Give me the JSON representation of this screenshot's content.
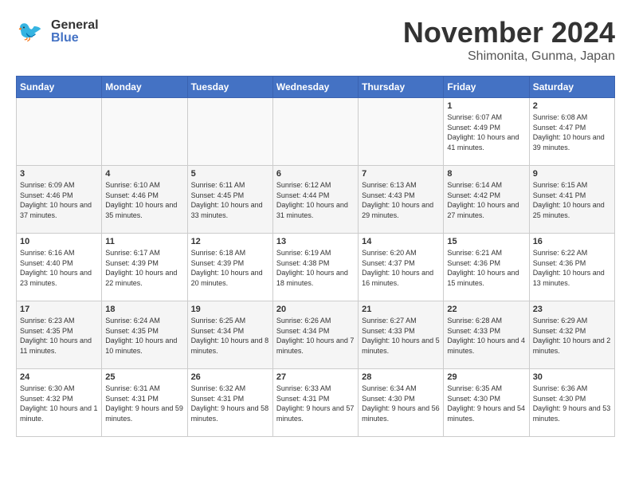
{
  "header": {
    "logo_general": "General",
    "logo_blue": "Blue",
    "title": "November 2024",
    "subtitle": "Shimonita, Gunma, Japan"
  },
  "days_of_week": [
    "Sunday",
    "Monday",
    "Tuesday",
    "Wednesday",
    "Thursday",
    "Friday",
    "Saturday"
  ],
  "weeks": [
    [
      {
        "day": "",
        "content": ""
      },
      {
        "day": "",
        "content": ""
      },
      {
        "day": "",
        "content": ""
      },
      {
        "day": "",
        "content": ""
      },
      {
        "day": "",
        "content": ""
      },
      {
        "day": "1",
        "content": "Sunrise: 6:07 AM\nSunset: 4:49 PM\nDaylight: 10 hours and 41 minutes."
      },
      {
        "day": "2",
        "content": "Sunrise: 6:08 AM\nSunset: 4:47 PM\nDaylight: 10 hours and 39 minutes."
      }
    ],
    [
      {
        "day": "3",
        "content": "Sunrise: 6:09 AM\nSunset: 4:46 PM\nDaylight: 10 hours and 37 minutes."
      },
      {
        "day": "4",
        "content": "Sunrise: 6:10 AM\nSunset: 4:46 PM\nDaylight: 10 hours and 35 minutes."
      },
      {
        "day": "5",
        "content": "Sunrise: 6:11 AM\nSunset: 4:45 PM\nDaylight: 10 hours and 33 minutes."
      },
      {
        "day": "6",
        "content": "Sunrise: 6:12 AM\nSunset: 4:44 PM\nDaylight: 10 hours and 31 minutes."
      },
      {
        "day": "7",
        "content": "Sunrise: 6:13 AM\nSunset: 4:43 PM\nDaylight: 10 hours and 29 minutes."
      },
      {
        "day": "8",
        "content": "Sunrise: 6:14 AM\nSunset: 4:42 PM\nDaylight: 10 hours and 27 minutes."
      },
      {
        "day": "9",
        "content": "Sunrise: 6:15 AM\nSunset: 4:41 PM\nDaylight: 10 hours and 25 minutes."
      }
    ],
    [
      {
        "day": "10",
        "content": "Sunrise: 6:16 AM\nSunset: 4:40 PM\nDaylight: 10 hours and 23 minutes."
      },
      {
        "day": "11",
        "content": "Sunrise: 6:17 AM\nSunset: 4:39 PM\nDaylight: 10 hours and 22 minutes."
      },
      {
        "day": "12",
        "content": "Sunrise: 6:18 AM\nSunset: 4:39 PM\nDaylight: 10 hours and 20 minutes."
      },
      {
        "day": "13",
        "content": "Sunrise: 6:19 AM\nSunset: 4:38 PM\nDaylight: 10 hours and 18 minutes."
      },
      {
        "day": "14",
        "content": "Sunrise: 6:20 AM\nSunset: 4:37 PM\nDaylight: 10 hours and 16 minutes."
      },
      {
        "day": "15",
        "content": "Sunrise: 6:21 AM\nSunset: 4:36 PM\nDaylight: 10 hours and 15 minutes."
      },
      {
        "day": "16",
        "content": "Sunrise: 6:22 AM\nSunset: 4:36 PM\nDaylight: 10 hours and 13 minutes."
      }
    ],
    [
      {
        "day": "17",
        "content": "Sunrise: 6:23 AM\nSunset: 4:35 PM\nDaylight: 10 hours and 11 minutes."
      },
      {
        "day": "18",
        "content": "Sunrise: 6:24 AM\nSunset: 4:35 PM\nDaylight: 10 hours and 10 minutes."
      },
      {
        "day": "19",
        "content": "Sunrise: 6:25 AM\nSunset: 4:34 PM\nDaylight: 10 hours and 8 minutes."
      },
      {
        "day": "20",
        "content": "Sunrise: 6:26 AM\nSunset: 4:34 PM\nDaylight: 10 hours and 7 minutes."
      },
      {
        "day": "21",
        "content": "Sunrise: 6:27 AM\nSunset: 4:33 PM\nDaylight: 10 hours and 5 minutes."
      },
      {
        "day": "22",
        "content": "Sunrise: 6:28 AM\nSunset: 4:33 PM\nDaylight: 10 hours and 4 minutes."
      },
      {
        "day": "23",
        "content": "Sunrise: 6:29 AM\nSunset: 4:32 PM\nDaylight: 10 hours and 2 minutes."
      }
    ],
    [
      {
        "day": "24",
        "content": "Sunrise: 6:30 AM\nSunset: 4:32 PM\nDaylight: 10 hours and 1 minute."
      },
      {
        "day": "25",
        "content": "Sunrise: 6:31 AM\nSunset: 4:31 PM\nDaylight: 9 hours and 59 minutes."
      },
      {
        "day": "26",
        "content": "Sunrise: 6:32 AM\nSunset: 4:31 PM\nDaylight: 9 hours and 58 minutes."
      },
      {
        "day": "27",
        "content": "Sunrise: 6:33 AM\nSunset: 4:31 PM\nDaylight: 9 hours and 57 minutes."
      },
      {
        "day": "28",
        "content": "Sunrise: 6:34 AM\nSunset: 4:30 PM\nDaylight: 9 hours and 56 minutes."
      },
      {
        "day": "29",
        "content": "Sunrise: 6:35 AM\nSunset: 4:30 PM\nDaylight: 9 hours and 54 minutes."
      },
      {
        "day": "30",
        "content": "Sunrise: 6:36 AM\nSunset: 4:30 PM\nDaylight: 9 hours and 53 minutes."
      }
    ]
  ]
}
